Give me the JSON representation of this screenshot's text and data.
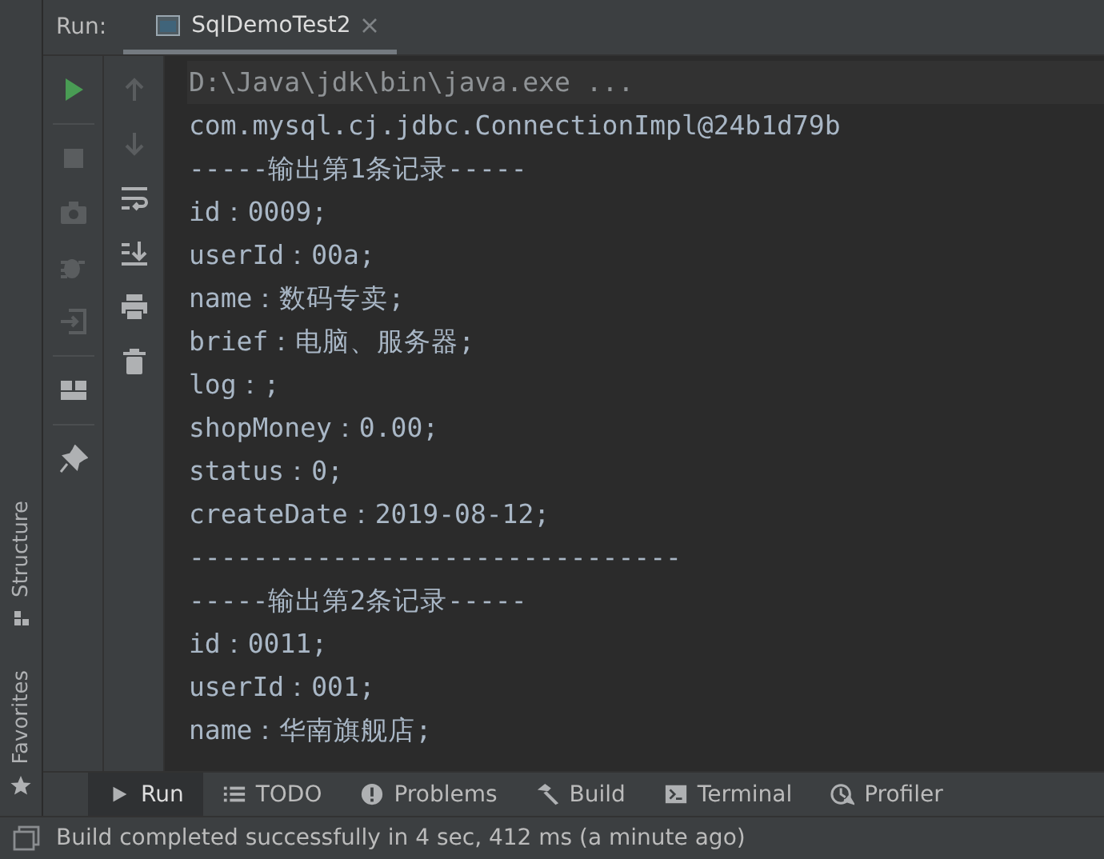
{
  "run_bar": {
    "label": "Run:",
    "tabs": [
      {
        "title": "SqlDemoTest2",
        "selected": true
      }
    ]
  },
  "side_stripe": [
    {
      "label": "Structure",
      "kind": "structure"
    },
    {
      "label": "Favorites",
      "kind": "star"
    }
  ],
  "toolbar_left": [
    {
      "kind": "run",
      "disabled": false
    },
    {
      "kind": "stop",
      "disabled": true
    },
    {
      "kind": "camera",
      "disabled": true
    },
    {
      "kind": "bug",
      "disabled": true
    },
    {
      "kind": "exit",
      "disabled": true
    },
    {
      "kind": "layout",
      "disabled": false
    },
    {
      "kind": "pin",
      "disabled": false
    }
  ],
  "toolbar_right": [
    {
      "kind": "up",
      "disabled": true
    },
    {
      "kind": "down",
      "disabled": true
    },
    {
      "kind": "wrap",
      "disabled": false
    },
    {
      "kind": "scroll-end",
      "disabled": false
    },
    {
      "kind": "print",
      "disabled": false
    },
    {
      "kind": "trash",
      "disabled": false
    }
  ],
  "console": [
    {
      "kind": "command",
      "text": "D:\\Java\\jdk\\bin\\java.exe ..."
    },
    {
      "kind": "output",
      "text": "com.mysql.cj.jdbc.ConnectionImpl@24b1d79b"
    },
    {
      "kind": "output",
      "text": "-----输出第1条记录-----"
    },
    {
      "kind": "output",
      "text": "id：0009;"
    },
    {
      "kind": "output",
      "text": "userId：00a;"
    },
    {
      "kind": "output",
      "text": "name：数码专卖;"
    },
    {
      "kind": "output",
      "text": "brief：电脑、服务器;"
    },
    {
      "kind": "output",
      "text": "log：;"
    },
    {
      "kind": "output",
      "text": "shopMoney：0.00;"
    },
    {
      "kind": "output",
      "text": "status：0;"
    },
    {
      "kind": "output",
      "text": "createDate：2019-08-12;"
    },
    {
      "kind": "output",
      "text": "-------------------------------"
    },
    {
      "kind": "output",
      "text": "-----输出第2条记录-----"
    },
    {
      "kind": "output",
      "text": "id：0011;"
    },
    {
      "kind": "output",
      "text": "userId：001;"
    },
    {
      "kind": "output",
      "text": "name：华南旗舰店;"
    }
  ],
  "bottom_tabs": [
    {
      "label": "Run",
      "kind": "run",
      "selected": true
    },
    {
      "label": "TODO",
      "kind": "list",
      "selected": false
    },
    {
      "label": "Problems",
      "kind": "problems",
      "selected": false
    },
    {
      "label": "Build",
      "kind": "hammer",
      "selected": false
    },
    {
      "label": "Terminal",
      "kind": "terminal",
      "selected": false
    },
    {
      "label": "Profiler",
      "kind": "profiler",
      "selected": false
    }
  ],
  "status_bar": {
    "text": "Build completed successfully in 4 sec, 412 ms (a minute ago)"
  }
}
